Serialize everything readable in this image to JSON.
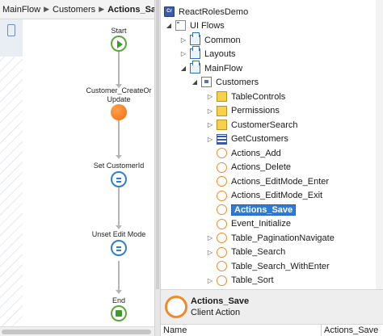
{
  "breadcrumb": {
    "items": [
      "MainFlow",
      "Customers"
    ],
    "current": "Actions_Save",
    "separator": "▶"
  },
  "flow": {
    "nodes": [
      {
        "kind": "start",
        "label": "Start"
      },
      {
        "kind": "action",
        "label": "Customer_CreateOr\nUpdate"
      },
      {
        "kind": "assign",
        "label": "Set CustomerId"
      },
      {
        "kind": "assign",
        "label": "Unset Edit Mode"
      },
      {
        "kind": "end",
        "label": "End"
      }
    ]
  },
  "tree": {
    "module": "ReactRolesDemo",
    "ui_flows": "UI Flows",
    "common": "Common",
    "layouts": "Layouts",
    "mainflow": "MainFlow",
    "customers": "Customers",
    "children": [
      {
        "label": "TableControls",
        "icon": "block-icon",
        "expander": "▷"
      },
      {
        "label": "Permissions",
        "icon": "block-icon",
        "expander": "▷"
      },
      {
        "label": "CustomerSearch",
        "icon": "block-icon",
        "expander": "▷"
      },
      {
        "label": "GetCustomers",
        "icon": "aggregate-icon",
        "expander": "▷"
      },
      {
        "label": "Actions_Add",
        "icon": "client-action-icon",
        "expander": ""
      },
      {
        "label": "Actions_Delete",
        "icon": "client-action-icon",
        "expander": ""
      },
      {
        "label": "Actions_EditMode_Enter",
        "icon": "client-action-icon",
        "expander": ""
      },
      {
        "label": "Actions_EditMode_Exit",
        "icon": "client-action-icon",
        "expander": ""
      },
      {
        "label": "Actions_Save",
        "icon": "client-action-icon",
        "expander": "",
        "selected": true
      },
      {
        "label": "Event_Initialize",
        "icon": "client-action-icon",
        "expander": ""
      },
      {
        "label": "Table_PaginationNavigate",
        "icon": "client-action-icon",
        "expander": "▷"
      },
      {
        "label": "Table_Search",
        "icon": "client-action-icon",
        "expander": "▷"
      },
      {
        "label": "Table_Search_WithEnter",
        "icon": "client-action-icon",
        "expander": ""
      },
      {
        "label": "Table_Sort",
        "icon": "client-action-icon",
        "expander": "▷"
      }
    ]
  },
  "detail": {
    "name": "Actions_Save",
    "type": "Client Action"
  },
  "properties": {
    "key": "Name",
    "value": "Actions_Save"
  },
  "icons": {
    "module": "Cr",
    "expanded": "◢",
    "collapsed": "▷"
  },
  "colors": {
    "selection": "#2f7ad6",
    "action": "#f08a2a",
    "start": "#3f9a2a",
    "assign": "#2e7fd3"
  }
}
